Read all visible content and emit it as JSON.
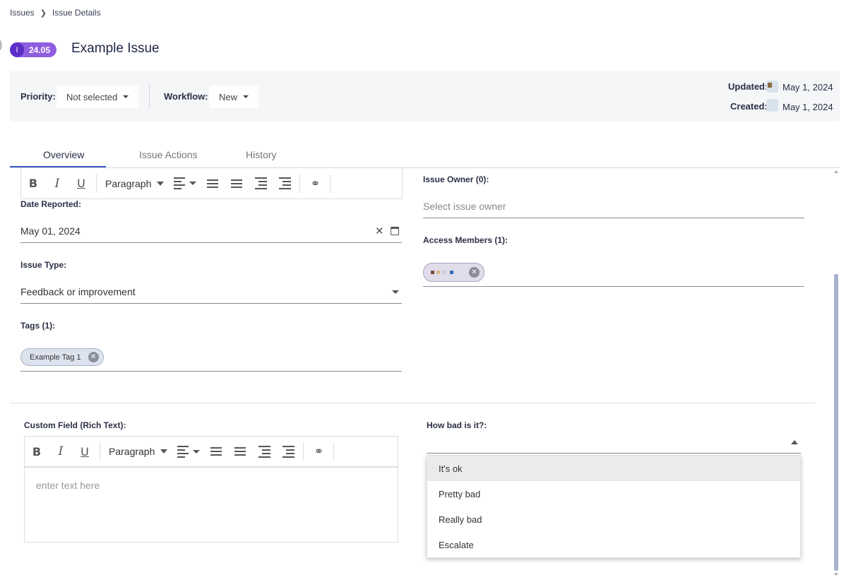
{
  "breadcrumb": {
    "root": "Issues",
    "current": "Issue Details"
  },
  "issue": {
    "badge_icon": "I",
    "badge_number": "24.05",
    "title": "Example Issue"
  },
  "meta": {
    "priority_label": "Priority:",
    "priority_value": "Not selected",
    "workflow_label": "Workflow:",
    "workflow_value": "New",
    "updated_label": "Updated:",
    "updated_date": "May 1, 2024",
    "created_label": "Created:",
    "created_date": "May 1, 2024"
  },
  "tabs": [
    {
      "label": "Overview",
      "active": true
    },
    {
      "label": "Issue Actions",
      "active": false
    },
    {
      "label": "History",
      "active": false
    }
  ],
  "toolbar": {
    "paragraph": "Paragraph"
  },
  "fields": {
    "date_reported_label": "Date Reported:",
    "date_reported_value": "May 01, 2024",
    "issue_type_label": "Issue Type:",
    "issue_type_value": "Feedback or improvement",
    "tags_label": "Tags (1):",
    "tags": [
      "Example Tag 1"
    ],
    "owner_label": "Issue Owner (0):",
    "owner_placeholder": "Select issue owner",
    "access_label": "Access Members (1):",
    "custom_rich_label": "Custom Field (Rich Text):",
    "custom_rich_placeholder": "enter text here",
    "how_bad_label": "How bad is it?:",
    "how_bad_options": [
      "It's ok",
      "Pretty bad",
      "Really bad",
      "Escalate"
    ]
  },
  "colors": {
    "accent": "#3b57c4",
    "badge": "#8f5ee0",
    "badge_dark": "#5c2fc7",
    "scrollbar": "#aab2cc"
  }
}
